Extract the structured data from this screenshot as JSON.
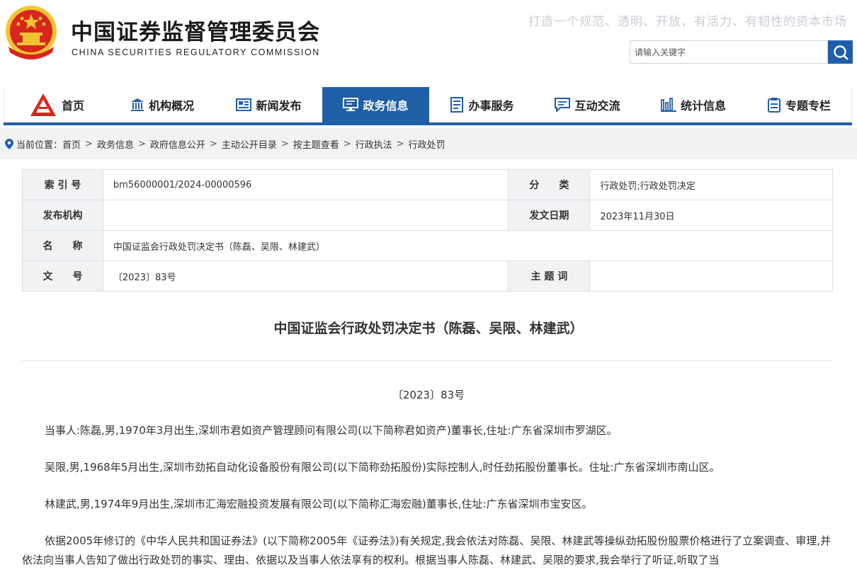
{
  "header": {
    "title_cn": "中国证券监督管理委员会",
    "title_en": "CHINA SECURITIES REGULATORY COMMISSION",
    "slogan": "打造一个规范、透明、开放、有活力、有韧性的资本市场",
    "search_placeholder": "请输入关键字"
  },
  "nav": {
    "items": [
      {
        "label": "首页",
        "icon": "csrc-logo-icon"
      },
      {
        "label": "机构概况",
        "icon": "building-icon"
      },
      {
        "label": "新闻发布",
        "icon": "newspaper-icon"
      },
      {
        "label": "政务信息",
        "icon": "monitor-icon",
        "active": true
      },
      {
        "label": "办事服务",
        "icon": "document-list-icon"
      },
      {
        "label": "互动交流",
        "icon": "chat-icon"
      },
      {
        "label": "统计信息",
        "icon": "bar-chart-icon"
      },
      {
        "label": "专题专栏",
        "icon": "clipboard-icon"
      }
    ],
    "active_color": "#1f5fa8"
  },
  "breadcrumb": {
    "prefix": "当前位置：",
    "items": [
      "首页",
      "政务信息",
      "政府信息公开",
      "主动公开目录",
      "按主题查看",
      "行政执法",
      "行政处罚"
    ],
    "separator": ">"
  },
  "info": {
    "index_label": "索 引 号",
    "index_value": "bm56000001/2024-00000596",
    "category_label": "分　　类",
    "category_value": "行政处罚;行政处罚决定",
    "publisher_label": "发布机构",
    "publisher_value": "",
    "date_label": "发文日期",
    "date_value": "2023年11月30日",
    "name_label": "名　　称",
    "name_value": "中国证监会行政处罚决定书（陈磊、吴限、林建武）",
    "docno_label": "文　　号",
    "docno_value": "〔2023〕83号",
    "keyword_label": "主 题 词",
    "keyword_value": ""
  },
  "document": {
    "title": "中国证监会行政处罚决定书（陈磊、吴限、林建武）",
    "number": "〔2023〕83号",
    "paragraphs": [
      "当事人:陈磊,男,1970年3月出生,深圳市君如资产管理顾问有限公司(以下简称君如资产)董事长,住址:广东省深圳市罗湖区。",
      "吴限,男,1968年5月出生,深圳市劲拓自动化设备股份有限公司(以下简称劲拓股份)实际控制人,时任劲拓股份董事长。住址:广东省深圳市南山区。",
      "林建武,男,1974年9月出生,深圳市汇海宏融投资发展有限公司(以下简称汇海宏融)董事长,住址:广东省深圳市宝安区。",
      "依据2005年修订的《中华人民共和国证券法》(以下简称2005年《证券法》)有关规定,我会依法对陈磊、吴限、林建武等操纵劲拓股份股票价格进行了立案调查、审理,并依法向当事人告知了做出行政处罚的事实、理由、依据以及当事人依法享有的权利。根据当事人陈磊、林建武、吴限的要求,我会举行了听证,听取了当"
    ]
  }
}
